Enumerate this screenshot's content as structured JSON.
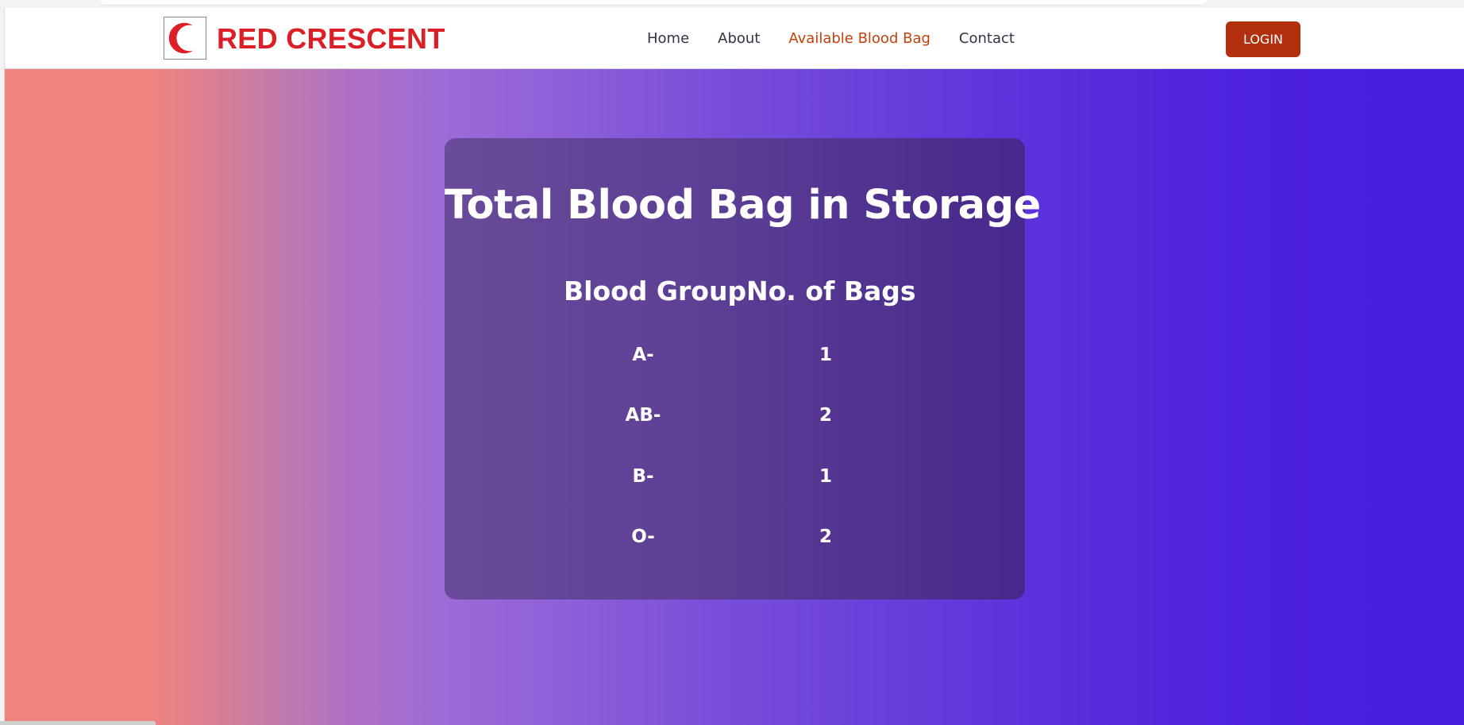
{
  "brand": {
    "name": "RED CRESCENT",
    "logo_icon": "crescent-icon",
    "logo_color": "#dc1f26"
  },
  "nav": {
    "items": [
      {
        "label": "Home",
        "active": false
      },
      {
        "label": "About",
        "active": false
      },
      {
        "label": "Available Blood Bag",
        "active": true
      },
      {
        "label": "Contact",
        "active": false
      }
    ],
    "active_color": "#c2410c",
    "login_label": "LOGIN",
    "login_color": "#b3300e"
  },
  "storage": {
    "title": "Total Blood Bag in Storage",
    "headers": [
      "Blood Group",
      "No. of Bags"
    ],
    "rows": [
      {
        "group": "A-",
        "bags": "1"
      },
      {
        "group": "AB-",
        "bags": "2"
      },
      {
        "group": "B-",
        "bags": "1"
      },
      {
        "group": "O-",
        "bags": "2"
      }
    ]
  },
  "colors": {
    "gradient_start": "#f0837d",
    "gradient_end": "#471cde",
    "card": "#5c3f95"
  }
}
